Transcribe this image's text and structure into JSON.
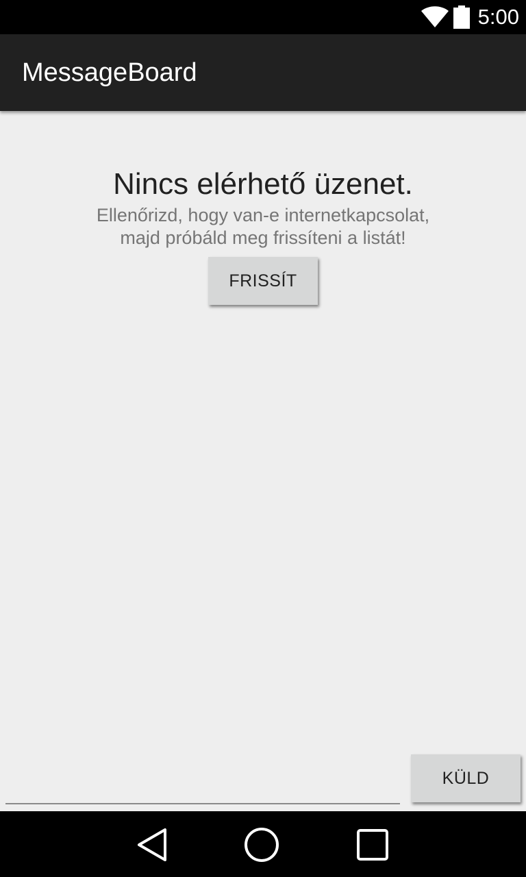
{
  "status_bar": {
    "time": "5:00",
    "icons": [
      "wifi-icon",
      "battery-icon"
    ]
  },
  "action_bar": {
    "title": "MessageBoard"
  },
  "empty_state": {
    "title": "Nincs elérhető üzenet.",
    "line1": "Ellenőrizd, hogy van-e internetkapcsolat,",
    "line2": "majd próbáld meg frissíteni a listát!",
    "refresh_label": "FRISSÍT"
  },
  "composer": {
    "input_value": "",
    "input_placeholder": "",
    "send_label": "KÜLD"
  },
  "nav_bar": {
    "icons": [
      "back-icon",
      "home-icon",
      "recents-icon"
    ]
  },
  "colors": {
    "background": "#eeeeee",
    "action_bar": "#212121",
    "button": "#d6d7d7",
    "secondary_text": "#757575"
  }
}
